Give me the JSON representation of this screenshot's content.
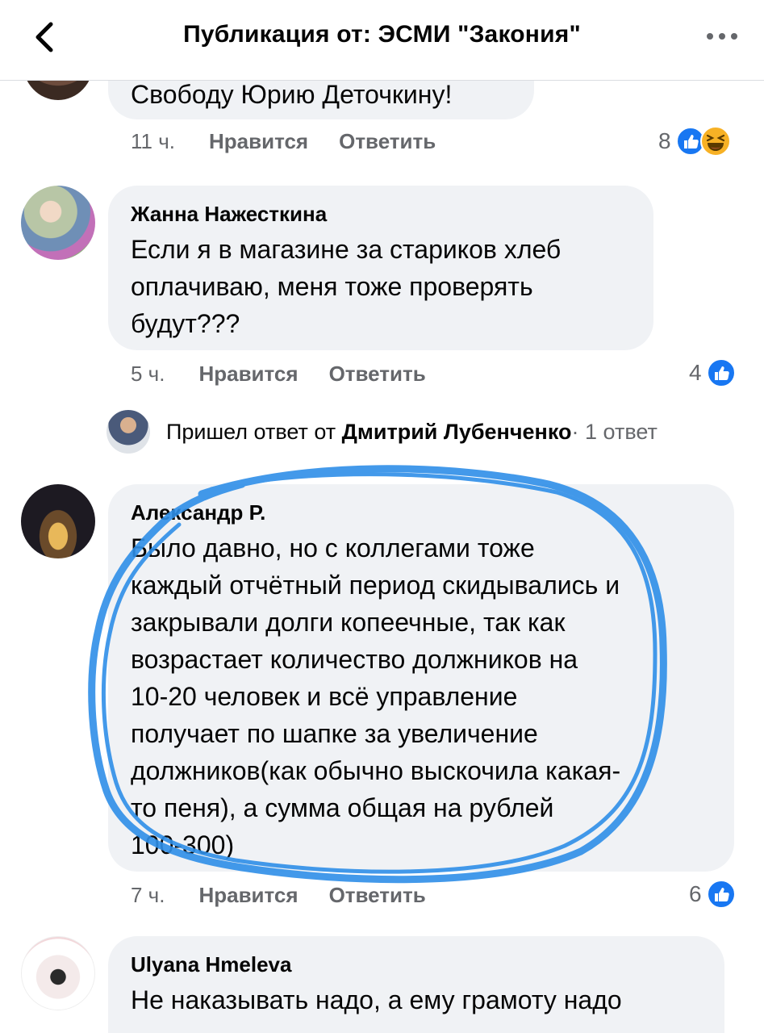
{
  "header": {
    "title": "Публикация от: ЭСМИ \"Закония\"",
    "back_icon": "chevron-left-icon",
    "more_icon": "ellipsis-icon"
  },
  "comments": [
    {
      "text": "Свободу Юрию Деточкину!",
      "time": "11 ч.",
      "like": "Нравится",
      "reply": "Ответить",
      "reactions": "8",
      "reaction_icons": [
        "like-icon",
        "haha-icon"
      ]
    },
    {
      "author": "Жанна Нажесткина",
      "text_lines": [
        "Если я в магазине за стариков хлеб",
        "оплачиваю, меня тоже проверять",
        "будут???"
      ],
      "time": "5 ч.",
      "like": "Нравится",
      "reply": "Ответить",
      "reactions": "4",
      "reaction_icons": [
        "like-icon"
      ]
    },
    {
      "author": "Александр Р.",
      "text_lines": [
        "Было давно,  но с коллегами тоже",
        "каждый отчётный период скидывались и",
        "закрывали долги копеечные, так как",
        "возрастает количество должников на",
        "10-20 человек и всё управление",
        "получает по шапке за увеличение",
        "должников(как обычно выскочила какая-",
        "то пеня), а сумма общая на рублей",
        "100-300)"
      ],
      "time": "7 ч.",
      "like": "Нравится",
      "reply": "Ответить",
      "reactions": "6",
      "reaction_icons": [
        "like-icon"
      ]
    },
    {
      "author": "Ulyana Hmeleva",
      "text_lines": [
        "Не наказывать надо, а ему грамоту надо"
      ]
    }
  ],
  "reply_summary": {
    "prefix": "Пришел ответ от",
    "name": "Дмитрий Лубенченко",
    "suffix": " · 1 ответ"
  },
  "colors": {
    "bubble": "#f0f2f5",
    "meta_text": "#65676b",
    "like_blue": "#1877f2",
    "haha_yellow": "#f7b125",
    "scribble_blue": "#2f8fe8"
  }
}
